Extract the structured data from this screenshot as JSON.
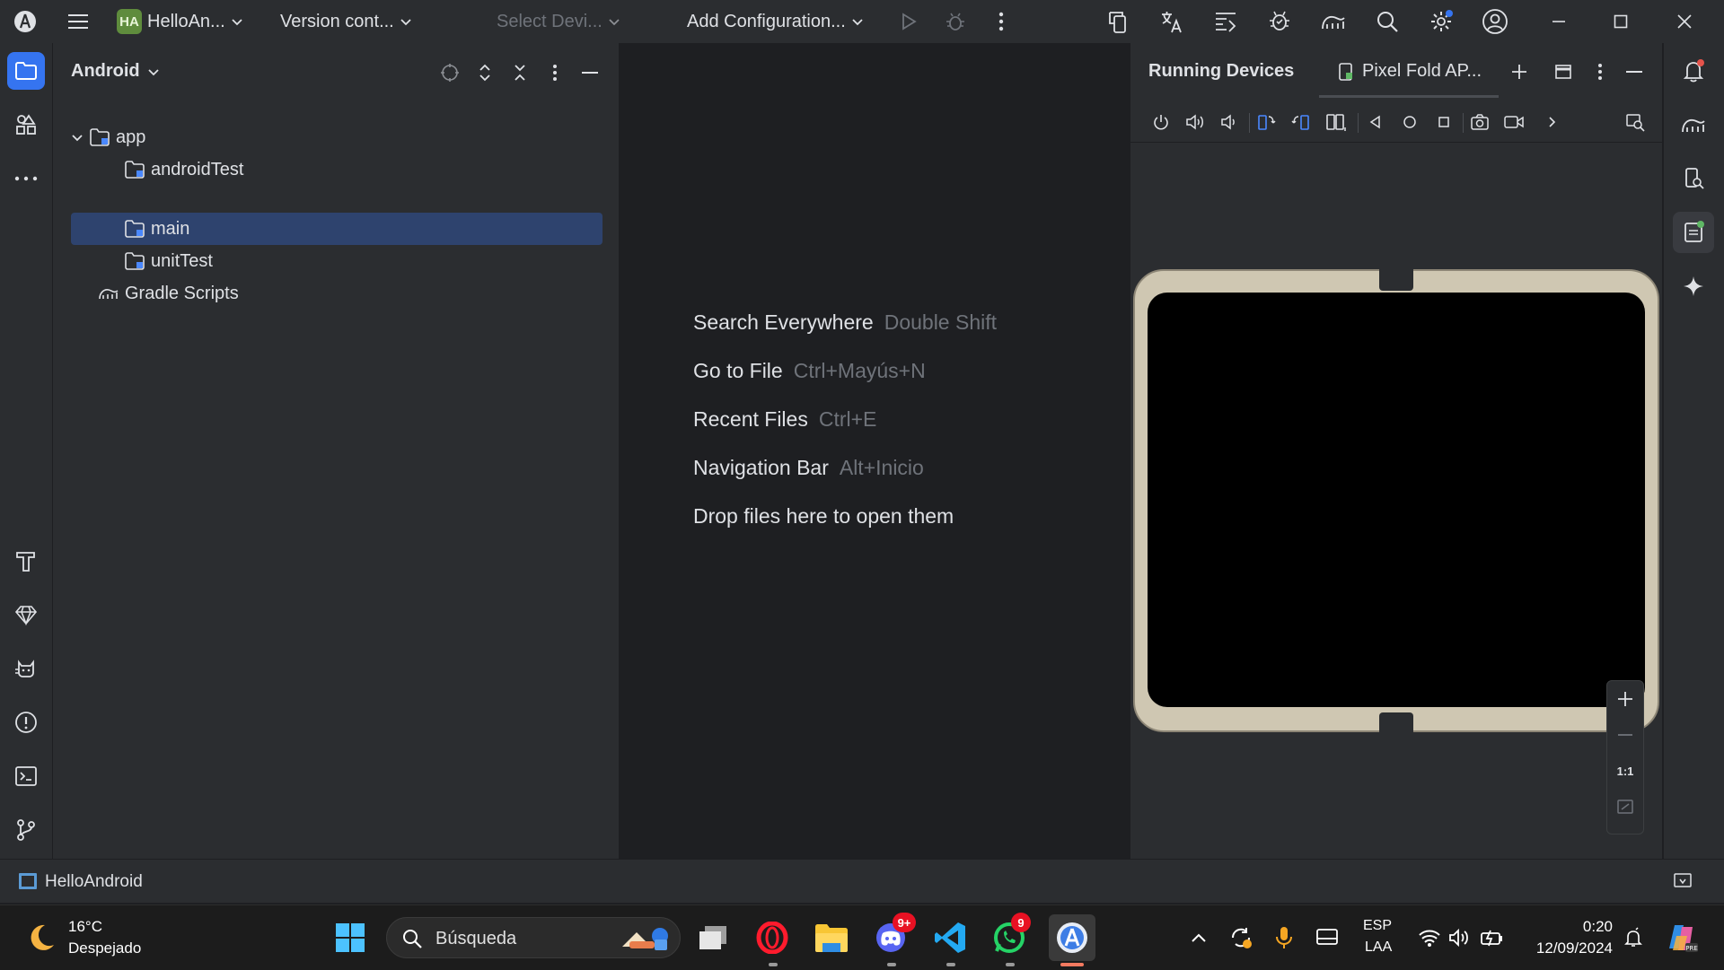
{
  "titlebar": {
    "project_badge": "HA",
    "project_name": "HelloAn...",
    "vcs_label": "Version cont...",
    "device_select": "Select Devi...",
    "run_config": "Add Configuration..."
  },
  "project_panel": {
    "view_label": "Android",
    "tree": [
      {
        "label": "app"
      },
      {
        "label": "androidTest"
      },
      {
        "label": "main"
      },
      {
        "label": "unitTest"
      },
      {
        "label": "Gradle Scripts"
      }
    ]
  },
  "editor_hints": [
    {
      "action": "Search Everywhere",
      "shortcut": "Double Shift"
    },
    {
      "action": "Go to File",
      "shortcut": "Ctrl+Mayús+N"
    },
    {
      "action": "Recent Files",
      "shortcut": "Ctrl+E"
    },
    {
      "action": "Navigation Bar",
      "shortcut": "Alt+Inicio"
    },
    {
      "action": "Drop files here to open them",
      "shortcut": ""
    }
  ],
  "running_devices": {
    "title": "Running Devices",
    "device_tab": "Pixel Fold AP...",
    "zoom_actual": "1:1"
  },
  "statusbar": {
    "project": "HelloAndroid"
  },
  "taskbar": {
    "weather_temp": "16°C",
    "weather_desc": "Despejado",
    "search_placeholder": "Búsqueda",
    "discord_badge": "9+",
    "whatsapp_badge": "9",
    "lang_top": "ESP",
    "lang_bottom": "LAA",
    "time": "0:20",
    "date": "12/09/2024"
  },
  "colors": {
    "accent": "#3574f0",
    "selection": "#2e436e",
    "panel_bg": "#2b2d30",
    "editor_bg": "#1e1f22"
  }
}
